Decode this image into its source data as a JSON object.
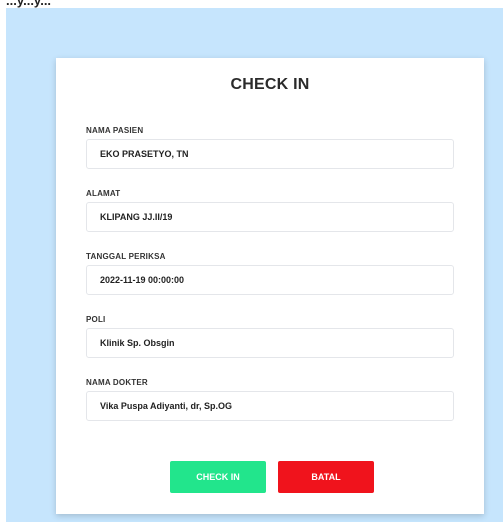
{
  "header": {
    "partial_text": "...y...y..."
  },
  "form": {
    "title": "CHECK IN",
    "fields": [
      {
        "label": "NAMA PASIEN",
        "value": "EKO PRASETYO, TN"
      },
      {
        "label": "ALAMAT",
        "value": "KLIPANG JJ.II/19"
      },
      {
        "label": "TANGGAL PERIKSA",
        "value": "2022-11-19 00:00:00"
      },
      {
        "label": "POLI",
        "value": "Klinik Sp. Obsgin"
      },
      {
        "label": "NAMA DOKTER",
        "value": "Vika Puspa Adiyanti, dr, Sp.OG"
      }
    ],
    "buttons": {
      "checkin_label": "CHECK IN",
      "batal_label": "BATAL"
    }
  },
  "colors": {
    "background": "#c6e5fd",
    "checkin_button": "#22e58c",
    "batal_button": "#f0131c"
  }
}
